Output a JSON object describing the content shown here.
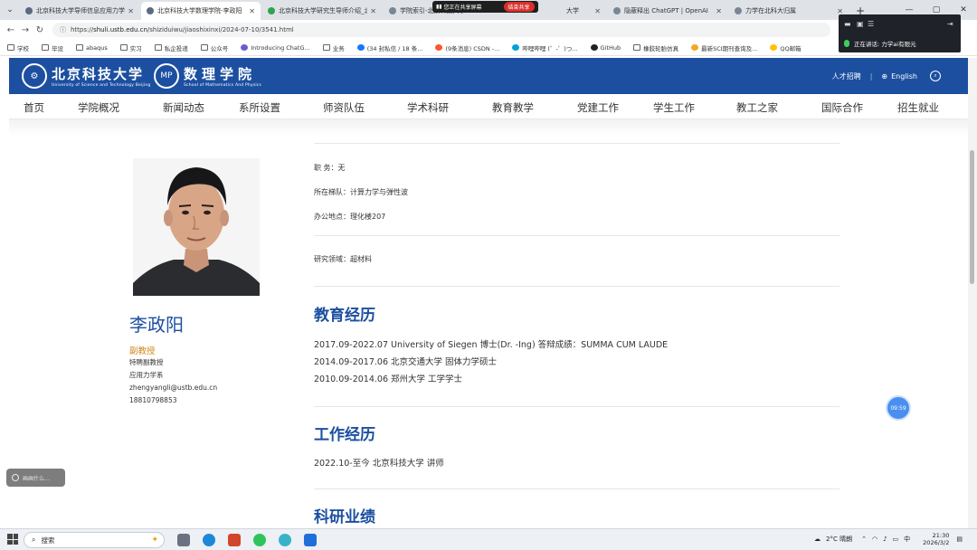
{
  "browser": {
    "tabs": [
      {
        "title": "北京科技大学导师信息应用力学系",
        "active": false
      },
      {
        "title": "北京科技大学数理学院-李政阳",
        "active": true
      },
      {
        "title": "北京科技大学研究生导师介绍_北京",
        "active": false
      },
      {
        "title": "学院索引-北京科技大学",
        "active": false
      },
      {
        "title": "大学",
        "active": false
      },
      {
        "title": "隐蔽释出 ChatGPT | OpenAI",
        "active": false
      },
      {
        "title": "力学在北科大归属",
        "active": false
      }
    ],
    "share_banner": {
      "text": "您正在共享屏幕",
      "stop_label": "结束共享"
    },
    "url_prefix": "https://",
    "url_host": "shuli.ustb.edu.cn",
    "url_path": "/shiziduiwu/jiaoshixinxi/2024-07-10/3541.html",
    "bookmarks": [
      "学校",
      "毕设",
      "abaqus",
      "实习",
      "私企投递",
      "公众号",
      "Introducing ChatG...",
      "业务",
      "(34 封私信 / 18 条...",
      "(9条消息) CSDN -...",
      "哔哩哔哩 (゜-゜)つ...",
      "GitHub",
      "橡胶轮胎仿真",
      "最新SCI期刊查询及...",
      "QQ邮箱"
    ]
  },
  "meeting": {
    "speaking_label": "正在讲话:",
    "speaker": "力学ai有限元"
  },
  "site": {
    "school_cn": "北京科技大学",
    "school_en": "University of Science and Technology Beijing",
    "dept_cn": "数理学院",
    "dept_en": "School of Mathematics And Physics",
    "recruit": "人才招聘",
    "english": "English",
    "nav": [
      "首页",
      "学院概况",
      "新闻动态",
      "系所设置",
      "师资队伍",
      "学术科研",
      "教育教学",
      "党建工作",
      "学生工作",
      "教工之家",
      "国际合作",
      "招生就业"
    ]
  },
  "profile": {
    "name": "李政阳",
    "title": "副教授",
    "subtitle": "特聘副教授",
    "department": "应用力学系",
    "email": "zhengyangli@ustb.edu.cn",
    "phone": "18810798853",
    "fields": {
      "duty": "职 务：无",
      "team": "所在梯队：计算力学与弹性波",
      "office": "办公地点：理化楼207",
      "research": "研究领域：超材料"
    },
    "education_heading": "教育经历",
    "education": [
      "2017.09-2022.07 University of Siegen 博士(Dr. -Ing) 答辩成绩：SUMMA CUM LAUDE",
      "2014.09-2017.06 北京交通大学 固体力学硕士",
      "2010.09-2014.06 郑州大学 工学学士"
    ],
    "work_heading": "工作经历",
    "work": [
      "2022.10-至今 北京科技大学 讲师"
    ],
    "research_heading": "科研业绩"
  },
  "overlay": {
    "timer": "09:59",
    "draw_hint": "画画什么..."
  },
  "taskbar": {
    "search": "搜索",
    "weather": "2°C 晴朗",
    "ime": "中",
    "time": "21:30",
    "date": "2026/3/2"
  }
}
